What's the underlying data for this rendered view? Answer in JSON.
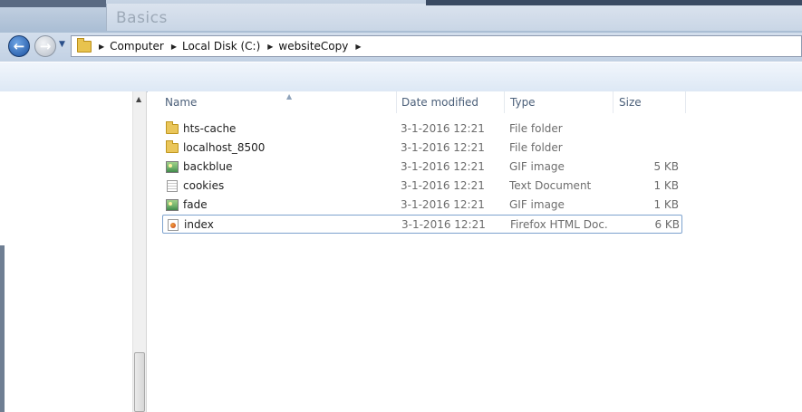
{
  "window": {
    "title": "Basics"
  },
  "address": {
    "crumbs": [
      "Computer",
      "Local Disk (C:)",
      "websiteCopy"
    ]
  },
  "columns": {
    "name": "Name",
    "date": "Date modified",
    "type": "Type",
    "size": "Size"
  },
  "files": [
    {
      "name": "hts-cache",
      "date": "3-1-2016 12:21",
      "type": "File folder",
      "size": "",
      "icon": "folder-icon"
    },
    {
      "name": "localhost_8500",
      "date": "3-1-2016 12:21",
      "type": "File folder",
      "size": "",
      "icon": "folder-icon"
    },
    {
      "name": "backblue",
      "date": "3-1-2016 12:21",
      "type": "GIF image",
      "size": "5 KB",
      "icon": "gif-image-icon"
    },
    {
      "name": "cookies",
      "date": "3-1-2016 12:21",
      "type": "Text Document",
      "size": "1 KB",
      "icon": "text-document-icon"
    },
    {
      "name": "fade",
      "date": "3-1-2016 12:21",
      "type": "GIF image",
      "size": "1 KB",
      "icon": "gif-image-icon"
    },
    {
      "name": "index",
      "date": "3-1-2016 12:21",
      "type": "Firefox HTML Doc...",
      "size": "6 KB",
      "icon": "firefox-html-icon"
    }
  ]
}
